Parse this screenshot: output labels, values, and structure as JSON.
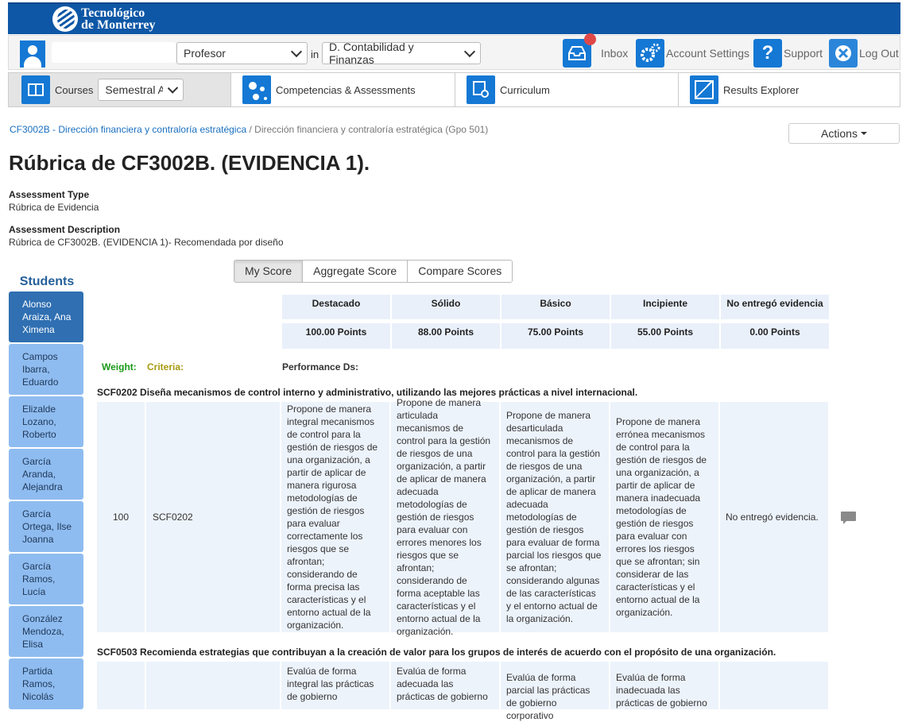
{
  "brand": {
    "logo_line1": "Tecnológico",
    "logo_line2": "de Monterrey"
  },
  "userbar": {
    "role_value": "Profesor",
    "in_label": "in",
    "department_value": "D. Contabilidad y Finanzas",
    "inbox_label": "Inbox",
    "account_label": "Account Settings",
    "support_label": "Support",
    "logout_label": "Log Out"
  },
  "nav": {
    "courses_label": "Courses",
    "courses_select": "Semestral Ac",
    "competencias_label": "Competencias & Assessments",
    "curriculum_label": "Curriculum",
    "results_label": "Results Explorer"
  },
  "breadcrumb": {
    "course_link": "CF3002B - Dirección financiera y contraloría estratégica",
    "separator": " / ",
    "current": "Dirección financiera y contraloría estratégica (Gpo 501)"
  },
  "actions_label": "Actions",
  "page_title": "Rúbrica de CF3002B. (EVIDENCIA 1).",
  "assessment": {
    "type_label": "Assessment Type",
    "type_value": "Rúbrica de Evidencia",
    "desc_label": "Assessment Description",
    "desc_value": "Rúbrica de CF3002B. (EVIDENCIA 1)- Recomendada por diseño"
  },
  "score_tabs": [
    "My Score",
    "Aggregate Score",
    "Compare Scores"
  ],
  "students_title": "Students",
  "students": [
    "Alonso Araiza, Ana Ximena",
    "Campos Ibarra, Eduardo",
    "Elizalde Lozano, Roberto",
    "García Aranda, Alejandra",
    "García Ortega, Ilse Joanna",
    "García Ramos, Lucía",
    "González Mendoza, Elisa",
    "Partida Ramos, Nicolás"
  ],
  "levels": [
    "Destacado",
    "Sólido",
    "Básico",
    "Incipiente",
    "No entregó evidencia"
  ],
  "points": [
    "100.00 Points",
    "88.00 Points",
    "75.00 Points",
    "55.00 Points",
    "0.00 Points"
  ],
  "column_labels": {
    "weight": "Weight:",
    "criteria": "Criteria:",
    "performance": "Performance Ds:"
  },
  "criteria": [
    {
      "title": "SCF0202 Diseña mecanismos de control interno y administrativo, utilizando las mejores prácticas a nivel internacional.",
      "weight": "100",
      "code": "SCF0202",
      "descriptors": [
        "Propone de manera integral mecanismos de control para la gestión de riesgos de una organización, a partir de aplicar de manera rigurosa metodologías de gestión de riesgos para evaluar correctamente los riesgos que se afrontan; considerando de forma precisa las características y el entorno actual de la organización.",
        "Propone de manera articulada mecanismos de control para la gestión de riesgos de una organización, a partir de aplicar de manera adecuada metodologías de gestión de riesgos para evaluar con errores menores los riesgos que se afrontan; considerando de forma aceptable las características y el entorno actual de la organización.",
        "Propone de manera desarticulada mecanismos de control para la gestión de riesgos de una organización, a partir de aplicar de manera adecuada metodologías de gestión de riesgos para evaluar de forma parcial los riesgos que se afrontan; considerando algunas de las características y el entorno actual de la organización.",
        "Propone de manera errónea mecanismos de control para la gestión de riesgos de una organización, a partir de aplicar de manera inadecuada metodologías de gestión de riesgos para evaluar con errores los riesgos que se afrontan; sin considerar de las características y el entorno actual de la organización.",
        "No entregó evidencia."
      ]
    },
    {
      "title": "SCF0503 Recomienda estrategias que contribuyan a la creación de valor para los grupos de interés de acuerdo con el propósito de una organización.",
      "weight": "",
      "code": "",
      "descriptors": [
        "Evalúa de forma integral las prácticas de gobierno",
        "Evalúa de forma adecuada las prácticas de gobierno",
        "Evalúa de forma parcial las prácticas de gobierno corporativo",
        "Evalúa de forma inadecuada las prácticas de gobierno",
        ""
      ]
    }
  ]
}
